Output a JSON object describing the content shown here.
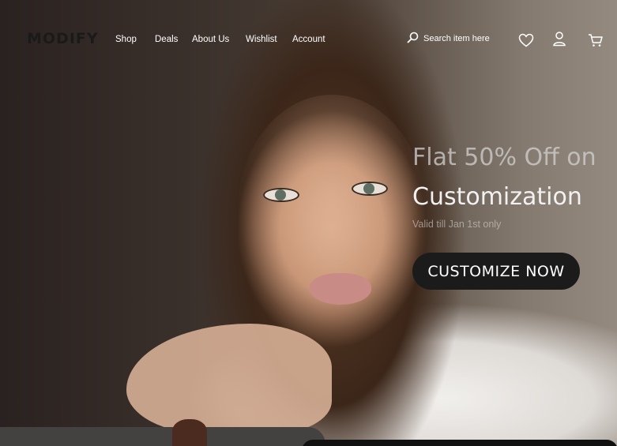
{
  "brand": {
    "logo": "MODIFY"
  },
  "nav": {
    "items": [
      {
        "label": "Shop"
      },
      {
        "label": "Deals"
      },
      {
        "label": "About Us"
      },
      {
        "label": "Wishlist"
      },
      {
        "label": "Account"
      }
    ],
    "search_placeholder": "Search item here",
    "icons": [
      "search-icon",
      "heart-icon",
      "user-icon",
      "cart-icon"
    ]
  },
  "hero": {
    "line1": "Flat 50% Off on",
    "line2": "Customization",
    "subtext": "Valid till Jan 1st only",
    "cta_label": "CUSTOMIZE NOW"
  },
  "colors": {
    "cta_bg": "#1c1b1b",
    "nav_text": "#ffffff",
    "logo": "#1a1a1a"
  }
}
